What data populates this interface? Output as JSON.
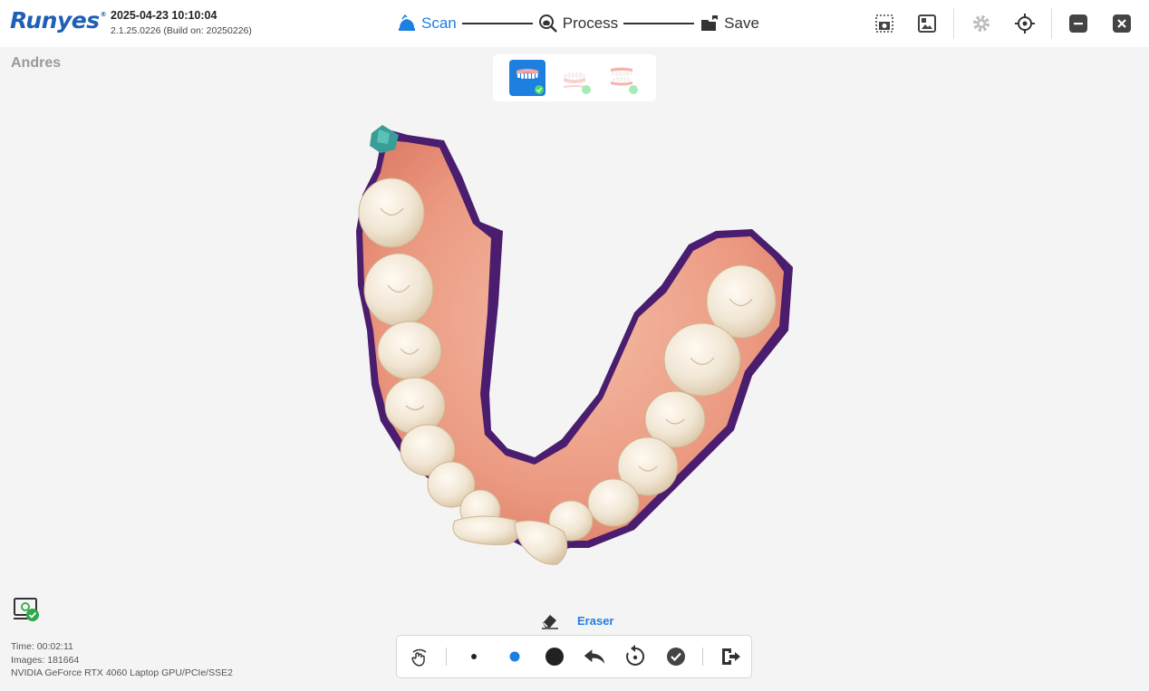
{
  "app": {
    "logo": "Runyes",
    "logo_mark": "®",
    "datetime": "2025-04-23 10:10:04",
    "version": "2.1.25.0226 (Build on: 20250226)"
  },
  "workflow": {
    "steps": [
      {
        "label": "Scan",
        "icon": "scan-icon",
        "active": true
      },
      {
        "label": "Process",
        "icon": "process-icon",
        "active": false
      },
      {
        "label": "Save",
        "icon": "save-icon",
        "active": false
      }
    ]
  },
  "toolbar_right": {
    "icons": [
      "screenshot-icon",
      "gallery-icon",
      "settings-icon",
      "locate-icon",
      "minimize-icon",
      "close-icon"
    ]
  },
  "patient": {
    "name": "Andres"
  },
  "jaw_selector": {
    "items": [
      {
        "name": "upper-jaw",
        "selected": true,
        "done": true
      },
      {
        "name": "lower-jaw",
        "selected": false,
        "done": true
      },
      {
        "name": "bite",
        "selected": false,
        "done": true
      }
    ]
  },
  "status": {
    "time": "Time: 00:02:11",
    "images": "Images: 181664",
    "gpu": "NVIDIA GeForce RTX 4060 Laptop GPU/PCIe/SSE2"
  },
  "tool": {
    "label": "Eraser",
    "icon": "eraser-icon"
  },
  "bottom_tools": [
    "hand-gesture-icon",
    "small-brush-icon",
    "medium-brush-icon",
    "large-brush-icon",
    "undo-icon",
    "reset-icon",
    "confirm-icon",
    "exit-icon"
  ],
  "colors": {
    "accent": "#1d7fe0",
    "brand": "#1f5fb6",
    "gingiva": "#f0a890",
    "tooth": "#f3ebdf",
    "edge": "#4a1d6e"
  }
}
